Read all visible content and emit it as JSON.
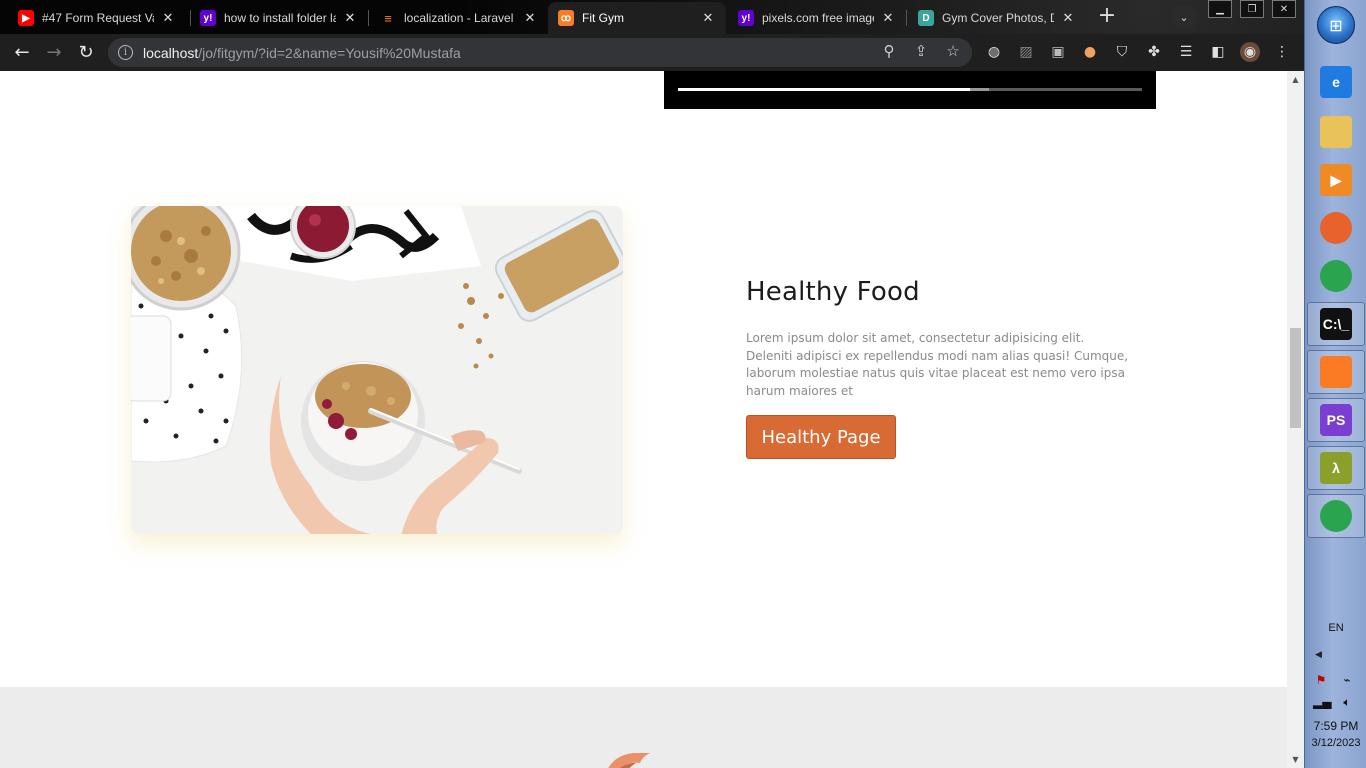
{
  "browser": {
    "tabs": [
      {
        "title": "#47 Form Request Va",
        "favicon": "youtube-icon",
        "color": "#ff0000",
        "active": false
      },
      {
        "title": "how to install folder la",
        "favicon": "yahoo-icon",
        "color": "#6001d2",
        "active": false
      },
      {
        "title": "localization - Laravel",
        "favicon": "stackoverflow-icon",
        "color": "#f48024",
        "active": false
      },
      {
        "title": "Fit Gym",
        "favicon": "xampp-icon",
        "color": "#fb7a24",
        "active": true
      },
      {
        "title": "pixels.com free image",
        "favicon": "yahoo-icon",
        "color": "#6001d2",
        "active": false
      },
      {
        "title": "Gym Cover Photos, Do",
        "favicon": "d-icon",
        "color": "#3aa59a",
        "active": false
      }
    ],
    "url_host": "localhost",
    "url_path": "/jo/fitgym/?id=2&name=Yousif%20Mustafa"
  },
  "page": {
    "video_progress": {
      "played": 0.63,
      "buffered": 0.67
    },
    "food": {
      "title": "Healthy Food",
      "description": "Lorem ipsum dolor sit amet, consectetur adipisicing elit. Deleniti adipisci ex repellendus modi nam alias quasi! Cumque, laborum molestiae natus quis vitae placeat est nemo vero ipsa harum maiores et",
      "button_label": "Healthy Page",
      "button_color": "#d86a34"
    }
  },
  "taskbar": {
    "apps": [
      {
        "name": "ie-icon",
        "label": "e",
        "color": "#1f7be0"
      },
      {
        "name": "file-explorer-icon",
        "label": "",
        "color": "#e9c25a"
      },
      {
        "name": "media-player-icon",
        "label": "▶",
        "color": "#f08a24"
      },
      {
        "name": "firefox-icon",
        "label": "",
        "color": "#e8622c"
      },
      {
        "name": "chrome-icon",
        "label": "",
        "color": "#2aa44f"
      },
      {
        "name": "cmd-icon",
        "label": "C:\\_",
        "color": "#111111"
      },
      {
        "name": "xampp-icon",
        "label": "",
        "color": "#fb7a24"
      },
      {
        "name": "phpstorm-icon",
        "label": "PS",
        "color": "#7a3fd1"
      },
      {
        "name": "lambda-icon",
        "label": "λ",
        "color": "#8aa02a"
      },
      {
        "name": "chrome-running-icon",
        "label": "",
        "color": "#2aa44f"
      }
    ],
    "language": "EN",
    "time": "7:59 PM",
    "date": "3/12/2023"
  }
}
